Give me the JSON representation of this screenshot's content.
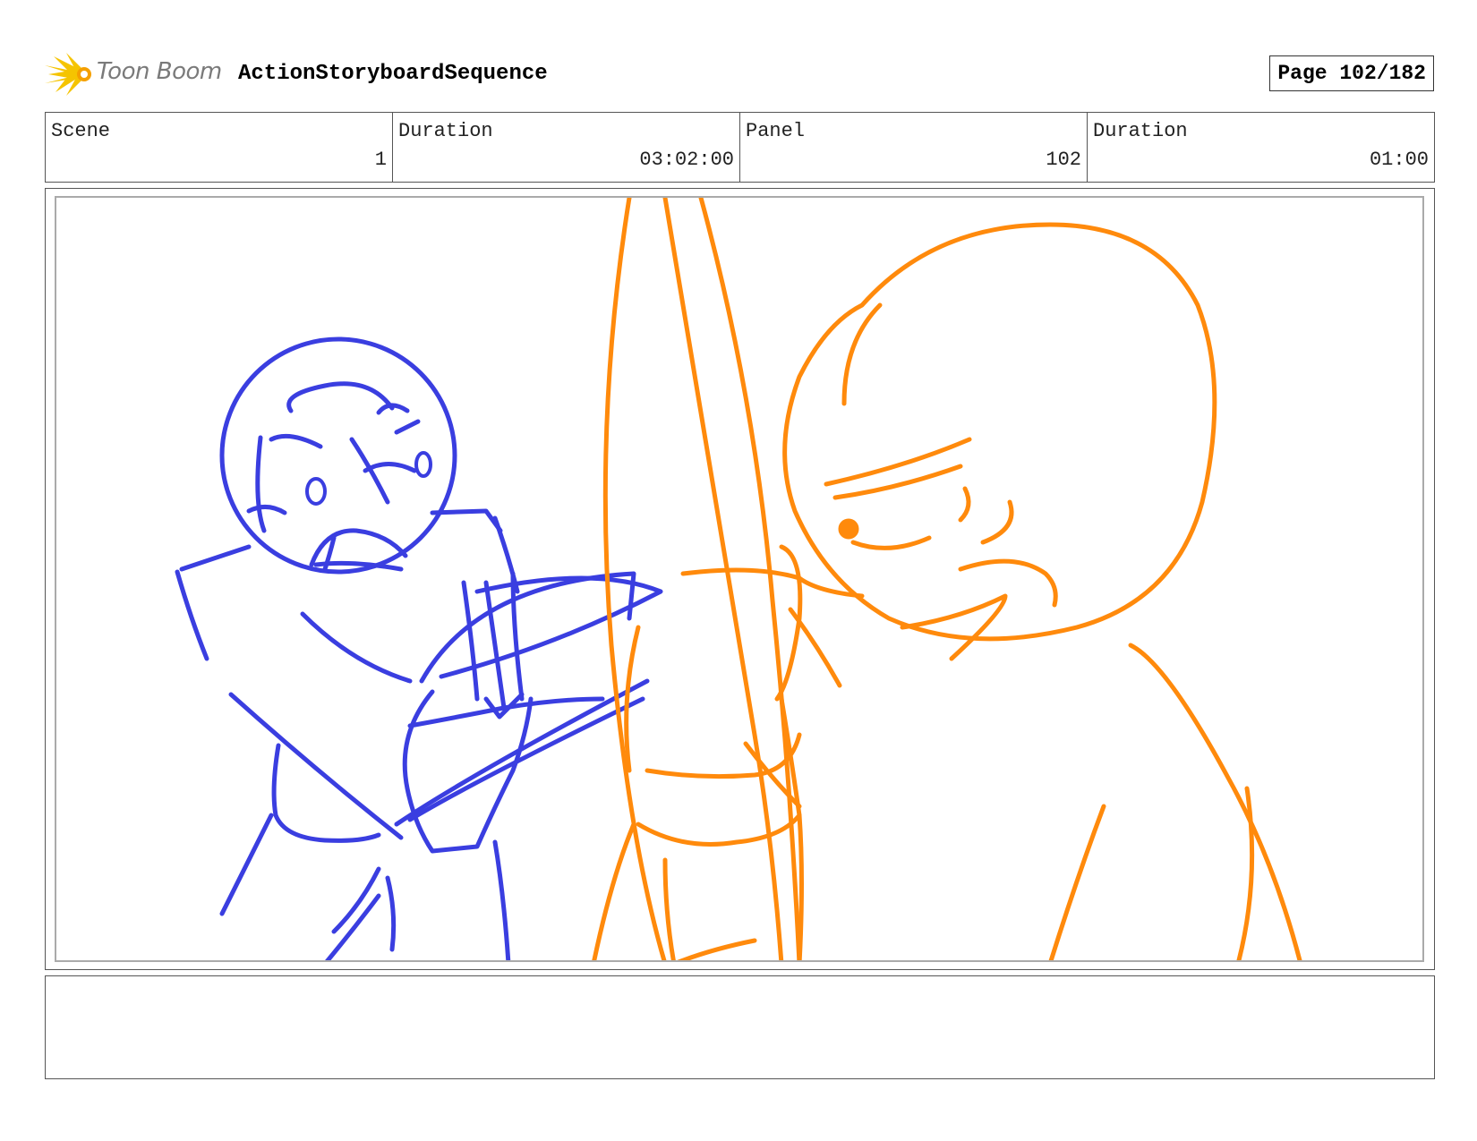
{
  "header": {
    "logo_text": "Toon Boom",
    "title": "ActionStoryboardSequence",
    "page_label": "Page 102/182"
  },
  "info": {
    "scene_label": "Scene",
    "scene_value": "1",
    "scene_duration_label": "Duration",
    "scene_duration_value": "03:02:00",
    "panel_label": "Panel",
    "panel_value": "102",
    "panel_duration_label": "Duration",
    "panel_duration_value": "01:00"
  },
  "colors": {
    "blue_sketch": "#3a3ee0",
    "orange_sketch": "#ff8a0c",
    "logo_yellow": "#f5c400"
  },
  "notes": {
    "text": ""
  }
}
